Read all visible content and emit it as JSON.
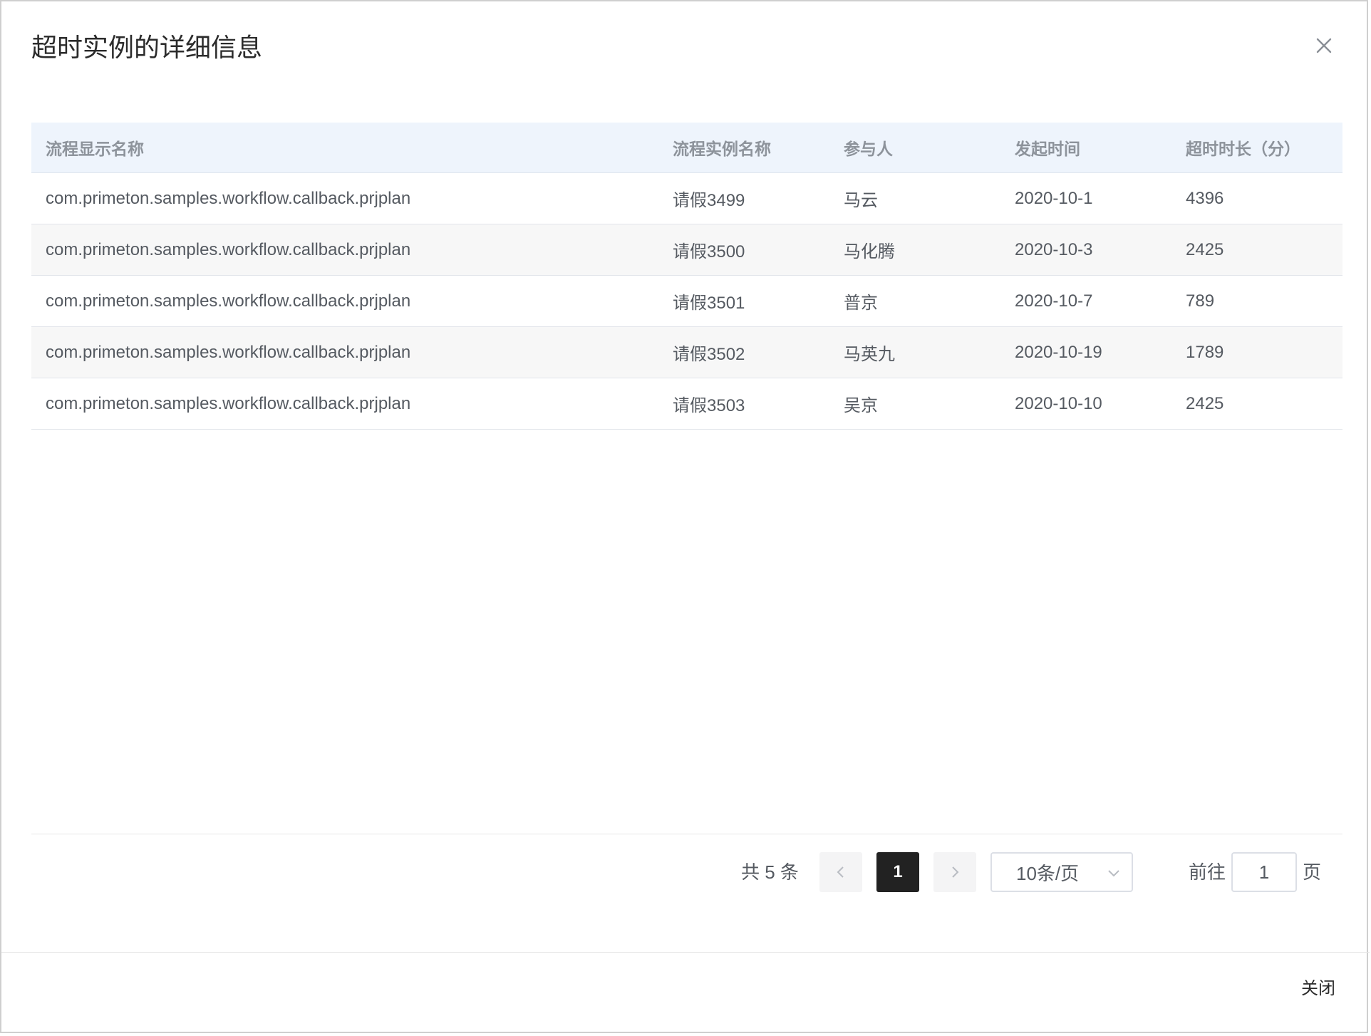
{
  "dialog": {
    "title": "超时实例的详细信息",
    "close_button": "关闭"
  },
  "table": {
    "headers": [
      "流程显示名称",
      "流程实例名称",
      "参与人",
      "发起时间",
      "超时时长（分）"
    ],
    "rows": [
      [
        "com.primeton.samples.workflow.callback.prjplan",
        "请假3499",
        "马云",
        "2020-10-1",
        "4396"
      ],
      [
        "com.primeton.samples.workflow.callback.prjplan",
        "请假3500",
        "马化腾",
        "2020-10-3",
        "2425"
      ],
      [
        "com.primeton.samples.workflow.callback.prjplan",
        "请假3501",
        "普京",
        "2020-10-7",
        "789"
      ],
      [
        "com.primeton.samples.workflow.callback.prjplan",
        "请假3502",
        "马英九",
        "2020-10-19",
        "1789"
      ],
      [
        "com.primeton.samples.workflow.callback.prjplan",
        "请假3503",
        "吴京",
        "2020-10-10",
        "2425"
      ]
    ]
  },
  "pagination": {
    "total_text": "共 5 条",
    "current_page": "1",
    "page_size": "10条/页",
    "goto_label": "前往",
    "goto_value": "1",
    "goto_unit": "页"
  },
  "colors": {
    "header_bg": "#eef4fc",
    "active_page": "#222222"
  }
}
